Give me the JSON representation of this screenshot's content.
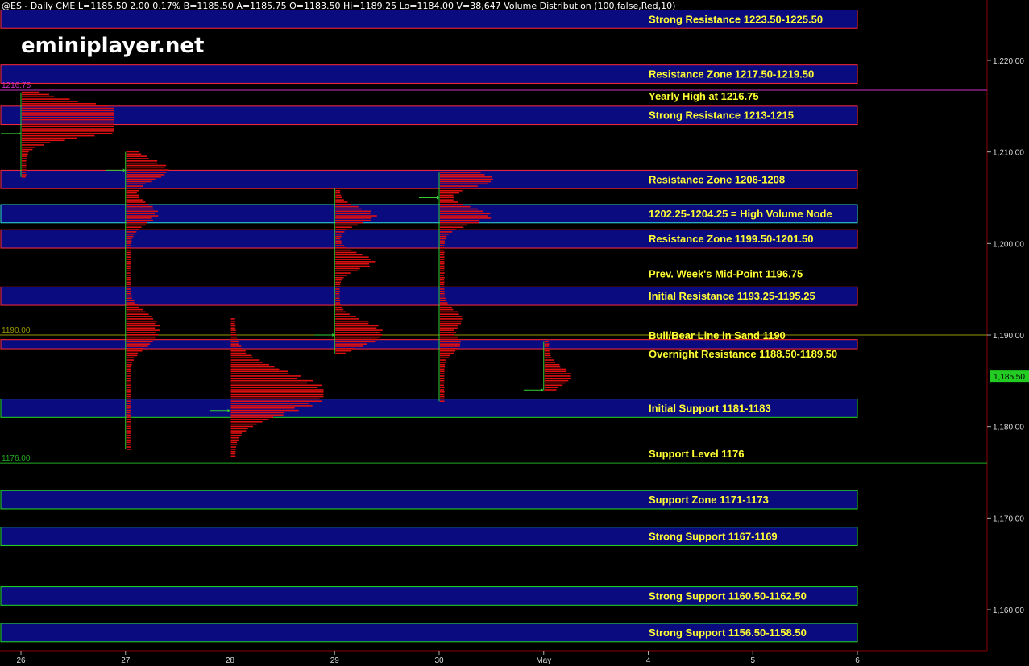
{
  "header": {
    "symbol": "@ES - Daily  CME",
    "last": "L=1185.50",
    "change": "2.00",
    "change_pct": "0.17%",
    "bid": "B=1185.50",
    "ask": "A=1185.75",
    "open": "O=1183.50",
    "high": "Hi=1189.25",
    "low": "Lo=1184.00",
    "volume": "V=38,647",
    "study": "Volume Distribution (100,false,Red,10)"
  },
  "brand": "eminiplayer.net",
  "colors": {
    "background": "#000000",
    "zone_fill": "#0b0b80",
    "resistance_border": "#ff2a3c",
    "support_border": "#22dd22",
    "hvn_border": "#33dddd",
    "label": "#ffff33",
    "profile": "#e01010",
    "axis_line": "#8b0000",
    "price_tag": "#22cc22",
    "yearly_high_line": "#cc33cc",
    "bull_bear_line": "#999900",
    "support_line": "#22aa22",
    "vpoc_marker": "#33cc33"
  },
  "chart_data": {
    "type": "volume_profile",
    "y_axis": {
      "range": [
        1155.0,
        1227.0
      ],
      "ticks": [
        1160,
        1170,
        1180,
        1190,
        1200,
        1210,
        1220
      ],
      "tick_labels": [
        "1,160.00",
        "1,170.00",
        "1,180.00",
        "1,190.00",
        "1,200.00",
        "1,210.00",
        "1,220.00"
      ]
    },
    "x_axis": {
      "labels": [
        "26",
        "27",
        "28",
        "29",
        "30",
        "May",
        "4",
        "5",
        "6"
      ]
    },
    "last_price": 1185.5,
    "last_price_label": "1,185.50",
    "zones": [
      {
        "low": 1223.5,
        "high": 1225.5,
        "kind": "resistance",
        "label": "Strong Resistance 1223.50-1225.50"
      },
      {
        "low": 1217.5,
        "high": 1219.5,
        "kind": "resistance",
        "label": "Resistance Zone 1217.50-1219.50"
      },
      {
        "low": 1213.0,
        "high": 1215.0,
        "kind": "resistance",
        "label": "Strong Resistance 1213-1215"
      },
      {
        "low": 1206.0,
        "high": 1208.0,
        "kind": "resistance",
        "label": "Resistance Zone 1206-1208"
      },
      {
        "low": 1202.25,
        "high": 1204.25,
        "kind": "hvn",
        "label": "1202.25-1204.25 = High Volume Node"
      },
      {
        "low": 1199.5,
        "high": 1201.5,
        "kind": "resistance",
        "label": "Resistance Zone 1199.50-1201.50"
      },
      {
        "low": 1193.25,
        "high": 1195.25,
        "kind": "resistance",
        "label": "Initial Resistance 1193.25-1195.25"
      },
      {
        "low": 1188.5,
        "high": 1189.5,
        "kind": "resistance",
        "label": "Overnight Resistance 1188.50-1189.50"
      },
      {
        "low": 1181.0,
        "high": 1183.0,
        "kind": "support",
        "label": "Initial Support 1181-1183"
      },
      {
        "low": 1171.0,
        "high": 1173.0,
        "kind": "support",
        "label": "Support Zone 1171-1173"
      },
      {
        "low": 1167.0,
        "high": 1169.0,
        "kind": "support",
        "label": "Strong Support 1167-1169"
      },
      {
        "low": 1160.5,
        "high": 1162.5,
        "kind": "support",
        "label": "Strong Support 1160.50-1162.50"
      },
      {
        "low": 1156.5,
        "high": 1158.5,
        "kind": "support",
        "label": "Strong Support 1156.50-1158.50"
      }
    ],
    "lines": [
      {
        "price": 1216.75,
        "kind": "yearly_high",
        "label": "Yearly High at 1216.75",
        "left_label": "1216.75"
      },
      {
        "price": 1196.75,
        "kind": "none",
        "label": "Prev. Week's Mid-Point 1196.75",
        "left_label": ""
      },
      {
        "price": 1190.0,
        "kind": "bull_bear",
        "label": "Bull/Bear Line in Sand 1190",
        "left_label": "1190.00"
      },
      {
        "price": 1176.0,
        "kind": "support_line",
        "label": "Support Level 1176",
        "left_label": "1176.00"
      }
    ],
    "profiles": [
      {
        "day": 0,
        "low": 1207.25,
        "high": 1216.5,
        "peaks": [
          [
            1213.75,
            1.0
          ],
          [
            1212.5,
            0.85
          ],
          [
            1215.0,
            0.45
          ]
        ],
        "spread": 1.4,
        "vpoc": 1212.0
      },
      {
        "day": 1,
        "low": 1177.5,
        "high": 1210.0,
        "peaks": [
          [
            1208.0,
            0.42
          ],
          [
            1203.25,
            0.3
          ],
          [
            1189.5,
            0.22
          ],
          [
            1191.5,
            0.24
          ]
        ],
        "spread": 1.6,
        "vpoc": 1208.0
      },
      {
        "day": 2,
        "low": 1176.75,
        "high": 1191.75,
        "peaks": [
          [
            1183.0,
            0.8
          ],
          [
            1185.25,
            0.42
          ]
        ],
        "spread": 2.5,
        "vpoc": 1181.75
      },
      {
        "day": 3,
        "low": 1188.0,
        "high": 1206.0,
        "peaks": [
          [
            1203.0,
            0.4
          ],
          [
            1198.0,
            0.38
          ],
          [
            1189.5,
            0.36
          ],
          [
            1191.0,
            0.34
          ]
        ],
        "spread": 1.2,
        "vpoc": 1190.0
      },
      {
        "day": 4,
        "low": 1182.75,
        "high": 1207.75,
        "peaks": [
          [
            1207.0,
            0.55
          ],
          [
            1203.0,
            0.52
          ],
          [
            1191.75,
            0.2
          ],
          [
            1189.0,
            0.18
          ]
        ],
        "spread": 1.3,
        "vpoc": 1205.0
      },
      {
        "day": 5,
        "low": 1184.0,
        "high": 1189.25,
        "peaks": [
          [
            1185.5,
            0.25
          ]
        ],
        "spread": 1.4,
        "vpoc": 1184.0
      }
    ]
  }
}
